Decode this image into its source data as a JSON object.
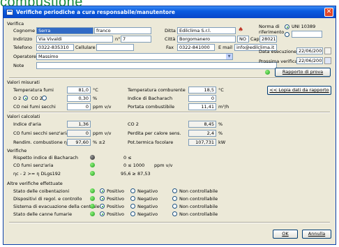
{
  "heading": "combustione",
  "window": {
    "title": "Verifiche periodiche a cura responsabile/manutentore"
  },
  "verifica": {
    "section_label": "Verifica",
    "cognome_label": "Cognome",
    "cognome_value": "Serra",
    "nome_value": "franco",
    "ditta_label": "Ditta",
    "ditta_value": "Edilclima S.r.l.",
    "indirizzo_label": "Indirizzo",
    "indirizzo_value": "Via Vivaldi",
    "num_label": "n°",
    "num_value": "7",
    "citta_label": "Città",
    "citta_value": "Borgomanero",
    "prov_value": "NO",
    "cap_label": "Cap",
    "cap_value": "28021",
    "telefono_label": "Telefono",
    "telefono_value": "0322-835310",
    "cellulare_label": "Cellulare",
    "cellulare_value": "",
    "fax_label": "Fax",
    "fax_value": "0322-841000",
    "email_label": "E mail",
    "email_value": "info@edilclima.it",
    "operatore_label": "Operatore",
    "operatore_value": "Massimo",
    "note_label": "Note",
    "note_value": "",
    "norma_label": "Norma di riferimento",
    "norma_value": "UNI 10389",
    "norma_other_value": "",
    "data_esecuzione_label": "Data esecuzione",
    "data_esecuzione_value": "22/06/2006",
    "prossima_verifica_label": "Prossima verifica",
    "prossima_verifica_value": "22/06/2007",
    "rapporto_label": "Rapporto di prova",
    "lopia_label": "<< Lopia dati da rapporto"
  },
  "valori_misurati": {
    "section_label": "Valori misurati",
    "temp_fumi_label": "Temperatura fumi",
    "temp_fumi_value": "81,0",
    "temp_fumi_unit": "°C",
    "temp_aria_label": "Temperatura comburente",
    "temp_aria_value": "18,5",
    "temp_aria_unit": "°C",
    "o2_label": "O 2",
    "co2_label": "CO 2",
    "o2_value": "0,30",
    "o2_unit": "%",
    "bacharach_label": "Indice di Bacharach",
    "bacharach_value": "0",
    "co_fumi_label": "CO nei fumi secchi",
    "co_fumi_value": "0",
    "co_fumi_unit": "ppm v/v",
    "portata_label": "Portata combustibile",
    "portata_value": "11,41",
    "portata_unit": "m³/h"
  },
  "valori_calcolati": {
    "section_label": "Valori calcolati",
    "indice_aria_label": "Indice d'aria",
    "indice_aria_value": "1,36",
    "co2_label": "CO 2",
    "co2_value": "8,45",
    "co2_unit": "%",
    "co_senza_aria_label": "CO fumi secchi senz'aria",
    "co_senza_aria_value": "0",
    "co_senza_aria_unit": "ppm v/v",
    "perdita_label": "Perdita per calore sens.",
    "perdita_value": "2,4",
    "perdita_unit": "%",
    "rendimento_label": "Rendim. combustione ηc",
    "rendimento_value": "97,60",
    "rendimento_unit": "% ±2",
    "pot_focolare_label": "Pot.termica focolare",
    "pot_focolare_value": "107,731",
    "pot_focolare_unit": "kW"
  },
  "verifiche": {
    "section_label": "Verifiche",
    "rispetto_label": "Rispetto indice di Bacharach",
    "rispetto_value": "0 ≤",
    "co_label": "CO fumi senz'aria",
    "co_value": "0 ≤ 1000",
    "co_unit": "ppm v/v",
    "eta_label": "ηc - 2 >= η DLgs192",
    "eta_value": "95,6 ≥ 87,53"
  },
  "altre_verifiche": {
    "section_label": "Altre verifiche effettuate",
    "options": {
      "positivo": "Positivo",
      "negativo": "Negativo",
      "non_controllabile": "Non controllabile"
    },
    "rows": [
      {
        "label": "Stato delle coibentazioni"
      },
      {
        "label": "Dispositivi di regol. e controllo"
      },
      {
        "label": "Sistema di evacuazione della centrale"
      },
      {
        "label": "Stato delle canne fumarie"
      }
    ]
  },
  "footer": {
    "ok_label": "OK",
    "annulla_label": "Annulla"
  },
  "colors": {
    "heading": "#1a8a3a",
    "titlebar": "#0a5be0",
    "dialog_bg": "#ece9d8",
    "status_ok": "#1c9a1c"
  }
}
